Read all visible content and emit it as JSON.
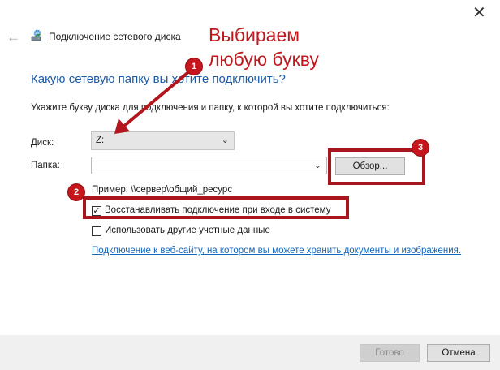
{
  "window": {
    "close_glyph": "✕",
    "back_glyph": "←",
    "title": "Подключение сетевого диска",
    "icon": "network-drive-icon"
  },
  "annotation": {
    "text": "Выбираем\nлюбую букву",
    "color": "#c0181f",
    "badges": [
      "1",
      "2",
      "3"
    ]
  },
  "main": {
    "heading": "Какую сетевую папку вы хотите подключить?",
    "instruction": "Укажите букву диска для подключения и папку, к которой вы хотите подключиться:",
    "drive_label": "Диск:",
    "drive_value": "Z:",
    "folder_label": "Папка:",
    "folder_value": "",
    "browse_label": "Обзор...",
    "example": "Пример: \\\\сервер\\общий_ресурс",
    "reconnect_label": "Восстанавливать подключение при входе в систему",
    "reconnect_checked": true,
    "other_credentials_label": "Использовать другие учетные данные",
    "other_credentials_checked": false,
    "link": "Подключение к веб-сайту, на котором вы можете хранить документы и изображения."
  },
  "footer": {
    "done_label": "Готово",
    "cancel_label": "Отмена"
  },
  "colors": {
    "heading": "#1c5aa6",
    "link": "#1566b8",
    "highlight": "#a8151c"
  }
}
